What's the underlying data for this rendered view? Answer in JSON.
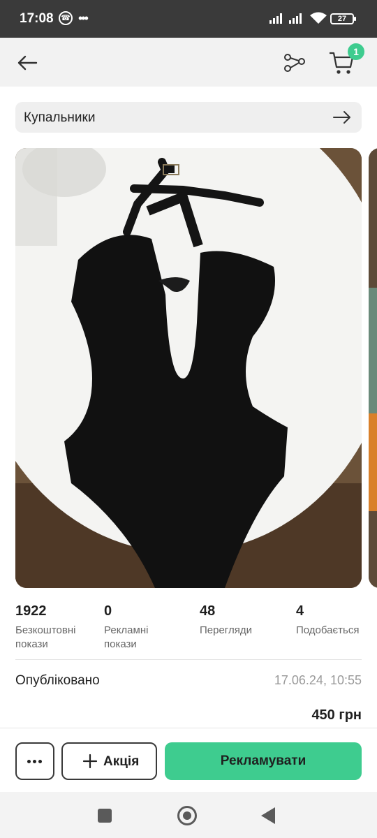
{
  "status_bar": {
    "time": "17:08",
    "battery": "27",
    "icons": [
      "viber-icon",
      "more-notifications-icon",
      "signal-icon",
      "signal-icon",
      "wifi-icon",
      "battery-icon"
    ]
  },
  "app_bar": {
    "icons": [
      "back-arrow-icon",
      "share-icon",
      "cart-icon"
    ],
    "cart_count": "1",
    "accent_color": "#3ecc8f"
  },
  "category": {
    "label": "Купальники",
    "icon": "arrow-right-icon"
  },
  "gallery": {
    "photos": [
      "black halter swimsuit photo",
      "next photo preview"
    ]
  },
  "stats": [
    {
      "value": "1922",
      "label": "Безкоштовні покази"
    },
    {
      "value": "0",
      "label": "Рекламні покази"
    },
    {
      "value": "48",
      "label": "Перегляди"
    },
    {
      "value": "4",
      "label": "Подобається"
    }
  ],
  "published": {
    "label": "Опубліковано",
    "date": "17.06.24, 10:55"
  },
  "price": "450 грн",
  "actions": {
    "promo_label": "Акція",
    "advertise_label": "Рекламувати"
  },
  "nav_bar": {
    "icons": [
      "recents-icon",
      "home-icon",
      "back-icon"
    ]
  }
}
